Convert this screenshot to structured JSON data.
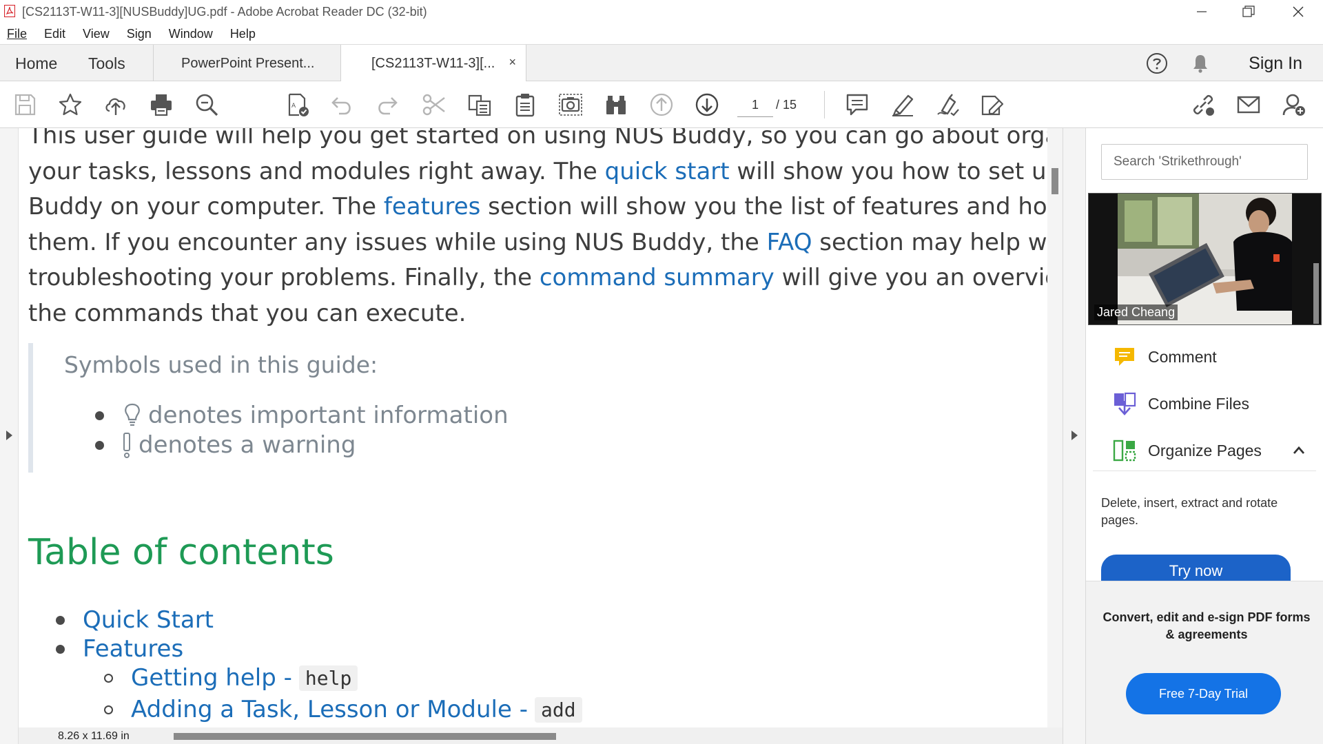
{
  "window": {
    "title": "[CS2113T-W11-3][NUSBuddy]UG.pdf - Adobe Acrobat Reader DC (32-bit)",
    "minimize_glyph": "—",
    "restore_glyph": "❐",
    "close_glyph": "✕"
  },
  "menu": {
    "file": "File",
    "edit": "Edit",
    "view": "View",
    "sign": "Sign",
    "window": "Window",
    "help": "Help"
  },
  "tabs": {
    "home": "Home",
    "tools": "Tools",
    "doc_tabs": [
      {
        "label": "PowerPoint Present..."
      },
      {
        "label": "[CS2113T-W11-3][..."
      }
    ],
    "close_glyph": "×",
    "sign_in": "Sign In"
  },
  "toolbar": {
    "page_current": "1",
    "page_total": "/ 15"
  },
  "document": {
    "intro": [
      [
        {
          "t": "This user guide will help you get started on using NUS Buddy, so you can go about organising"
        }
      ],
      [
        {
          "t": "your tasks, lessons and modules right away. The "
        },
        {
          "t": "quick start",
          "link": true
        },
        {
          "t": " will show you how to set up NUS"
        }
      ],
      [
        {
          "t": "Buddy on your computer. The "
        },
        {
          "t": "features",
          "link": true
        },
        {
          "t": " section will show you the list of features and how to u"
        }
      ],
      [
        {
          "t": "them. If you encounter any issues while using NUS Buddy, the "
        },
        {
          "t": "FAQ",
          "link": true
        },
        {
          "t": " section may help with"
        }
      ],
      [
        {
          "t": "troubleshooting your problems. Finally, the "
        },
        {
          "t": "command summary",
          "link": true
        },
        {
          "t": " will give you an overview of a"
        }
      ],
      [
        {
          "t": "the commands that you can execute."
        }
      ]
    ],
    "symbols_title": "Symbols used in this guide:",
    "symbol_info": "denotes important information",
    "symbol_warning": "denotes a warning",
    "toc_heading": "Table of contents",
    "toc": {
      "quick_start": "Quick Start",
      "features": "Features",
      "getting_help": "Getting help - ",
      "getting_help_code": "help",
      "adding": "Adding a Task, Lesson or Module - ",
      "adding_code": "add"
    },
    "page_size": "8.26 x 11.69 in"
  },
  "right_panel": {
    "search_placeholder": "Search 'Strikethrough'",
    "participant_name": "Jared Cheang",
    "tools": {
      "comment": "Comment",
      "combine": "Combine Files",
      "organize": "Organize Pages"
    },
    "organize_desc": "Delete, insert, extract and rotate pages.",
    "try_now": "Try now",
    "promo_text": "Convert, edit and e-sign PDF forms & agreements",
    "trial_button": "Free 7-Day Trial"
  },
  "colors": {
    "link": "#1b6db8",
    "heading_green": "#1e9a55",
    "accent_blue": "#1473e6",
    "acrobat_red": "#d7282f",
    "comment_yellow": "#f5b800",
    "combine_purple": "#6b5fd6",
    "organize_green": "#3aa844"
  }
}
